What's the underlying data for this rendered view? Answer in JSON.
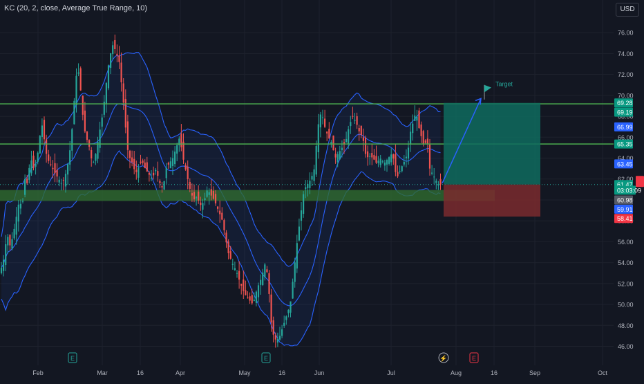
{
  "header": {
    "indicator_label": "KC (20, 2, close, Average True Range, 10)",
    "currency": "USD"
  },
  "colors": {
    "background": "#131722",
    "grid": "#1e222d",
    "text": "#b2b5be",
    "up": "#26a69a",
    "down": "#ef5350",
    "band": "#2962ff",
    "level_line": "#4caf50",
    "target_zone": "#0f6b5e",
    "stop_zone": "#7a2a2e",
    "support_zone": "#2f6b2f"
  },
  "chart_data": {
    "type": "candlestick",
    "title": "",
    "x_ticks": [
      "Feb",
      "Mar",
      "16",
      "Apr",
      "May",
      "16",
      "Jun",
      "Jul",
      "Aug",
      "16",
      "Sep",
      "Oct"
    ],
    "y_ticks": [
      "76.00",
      "74.00",
      "72.00",
      "70.00",
      "68.00",
      "66.00",
      "64.00",
      "62.00",
      "60.00",
      "58.00",
      "56.00",
      "54.00",
      "52.00",
      "50.00",
      "48.00",
      "46.00"
    ],
    "ylim": [
      44.6,
      77.6
    ],
    "grid": true,
    "keltner_channel": {
      "length": 20,
      "multiplier": 2,
      "source": "close",
      "band_style": "Average True Range",
      "atr_length": 10
    },
    "close_path": [
      [
        0,
        53
      ],
      [
        6,
        54.5
      ],
      [
        10,
        56.8
      ],
      [
        15,
        55.5
      ],
      [
        20,
        57
      ],
      [
        24,
        58.5
      ],
      [
        28,
        60
      ],
      [
        32,
        59.2
      ],
      [
        36,
        62
      ],
      [
        40,
        61.5
      ],
      [
        44,
        64.2
      ],
      [
        48,
        63
      ],
      [
        52,
        63.5
      ],
      [
        56,
        65
      ],
      [
        60,
        67.5
      ],
      [
        64,
        65.8
      ],
      [
        68,
        64
      ],
      [
        72,
        63.5
      ],
      [
        76,
        63
      ],
      [
        80,
        62.5
      ],
      [
        85,
        62
      ],
      [
        90,
        61.5
      ],
      [
        95,
        62.5
      ],
      [
        100,
        64
      ],
      [
        104,
        66.5
      ],
      [
        108,
        70
      ],
      [
        112,
        73
      ],
      [
        116,
        71
      ],
      [
        120,
        68
      ],
      [
        124,
        66
      ],
      [
        128,
        65.5
      ],
      [
        132,
        64
      ],
      [
        136,
        63.5
      ],
      [
        140,
        65
      ],
      [
        144,
        66.5
      ],
      [
        148,
        68
      ],
      [
        152,
        70
      ],
      [
        156,
        72.5
      ],
      [
        160,
        74
      ],
      [
        164,
        75
      ],
      [
        168,
        74
      ],
      [
        172,
        73.5
      ],
      [
        176,
        71
      ],
      [
        180,
        68.5
      ],
      [
        184,
        65
      ],
      [
        188,
        64
      ],
      [
        192,
        63.5
      ],
      [
        196,
        62.5
      ],
      [
        200,
        63
      ],
      [
        205,
        63.8
      ],
      [
        210,
        63
      ],
      [
        215,
        62.5
      ],
      [
        220,
        62
      ],
      [
        226,
        63
      ],
      [
        230,
        61.8
      ],
      [
        236,
        61
      ],
      [
        240,
        63
      ],
      [
        245,
        63.5
      ],
      [
        250,
        64
      ],
      [
        255,
        65
      ],
      [
        260,
        66
      ],
      [
        265,
        64
      ],
      [
        270,
        62.5
      ],
      [
        275,
        61
      ],
      [
        280,
        60
      ],
      [
        285,
        60.3
      ],
      [
        290,
        59.5
      ],
      [
        295,
        59.8
      ],
      [
        300,
        61
      ],
      [
        305,
        60.5
      ],
      [
        310,
        60
      ],
      [
        316,
        59
      ],
      [
        322,
        58
      ],
      [
        326,
        56.5
      ],
      [
        330,
        55
      ],
      [
        336,
        54
      ],
      [
        342,
        53.2
      ],
      [
        348,
        52
      ],
      [
        354,
        51
      ],
      [
        360,
        50.5
      ],
      [
        366,
        50
      ],
      [
        372,
        51.5
      ],
      [
        378,
        52.5
      ],
      [
        384,
        54
      ],
      [
        388,
        52.5
      ],
      [
        392,
        48.5
      ],
      [
        396,
        47
      ],
      [
        400,
        46.5
      ],
      [
        405,
        47
      ],
      [
        410,
        48
      ],
      [
        415,
        49
      ],
      [
        420,
        50
      ],
      [
        425,
        53
      ],
      [
        430,
        56
      ],
      [
        435,
        58.5
      ],
      [
        440,
        61
      ],
      [
        445,
        61.5
      ],
      [
        450,
        62
      ],
      [
        455,
        63
      ],
      [
        460,
        67
      ],
      [
        465,
        68.5
      ],
      [
        470,
        67
      ],
      [
        475,
        66
      ],
      [
        480,
        65.5
      ],
      [
        485,
        64
      ],
      [
        490,
        64.5
      ],
      [
        495,
        65
      ],
      [
        500,
        65.5
      ],
      [
        505,
        67
      ],
      [
        510,
        68
      ],
      [
        515,
        67.5
      ],
      [
        520,
        66.5
      ],
      [
        525,
        66
      ],
      [
        530,
        64
      ],
      [
        535,
        64.2
      ],
      [
        540,
        64
      ],
      [
        545,
        63.5
      ],
      [
        550,
        64
      ],
      [
        556,
        63.5
      ],
      [
        562,
        64
      ],
      [
        568,
        64.5
      ],
      [
        574,
        62
      ],
      [
        580,
        63
      ],
      [
        586,
        63.8
      ],
      [
        590,
        64.5
      ],
      [
        594,
        66.5
      ],
      [
        598,
        67.5
      ],
      [
        602,
        68.5
      ],
      [
        606,
        67
      ],
      [
        610,
        66
      ],
      [
        614,
        65
      ],
      [
        618,
        66
      ],
      [
        622,
        63
      ],
      [
        626,
        62.5
      ],
      [
        630,
        62
      ],
      [
        634,
        61.5
      ],
      [
        638,
        61.47
      ]
    ],
    "last_price": 61.47,
    "price_labels": [
      {
        "text": "69.28",
        "value": 69.28,
        "bg": "#089981"
      },
      {
        "text": "69.19",
        "value": 68.39,
        "bg": "#089981"
      },
      {
        "text": "66.99",
        "value": 66.99,
        "bg": "#2962ff"
      },
      {
        "text": "65.35",
        "value": 65.35,
        "bg": "#089981"
      },
      {
        "text": "63.45",
        "value": 63.45,
        "bg": "#2962ff"
      },
      {
        "text": "61.47",
        "value": 61.47,
        "bg": "#089981"
      },
      {
        "text": "03:03:09",
        "value": 60.93,
        "bg": "#089981"
      },
      {
        "text": "60.98",
        "value": 60.0,
        "bg": "#555a66"
      },
      {
        "text": "59.91",
        "value": 59.11,
        "bg": "#2962ff"
      },
      {
        "text": "58.41",
        "value": 58.23,
        "bg": "#f23645"
      }
    ],
    "horizontal_levels": [
      69.19,
      65.35
    ],
    "support_zone": [
      59.9,
      60.95
    ],
    "trade_setup": {
      "entry": 61.47,
      "target": 69.28,
      "stop": 58.41,
      "target_label": "Target",
      "arrow_from": [
        640,
        61.6
      ],
      "arrow_to": [
        696,
        69.7
      ]
    },
    "event_markers": [
      {
        "label": "E",
        "x_tick": "Feb"
      },
      {
        "label": "E",
        "x_tick": "May"
      },
      {
        "label": "⚡",
        "x_tick": "Jul"
      },
      {
        "label": "E",
        "x_tick": "Aug"
      }
    ]
  }
}
